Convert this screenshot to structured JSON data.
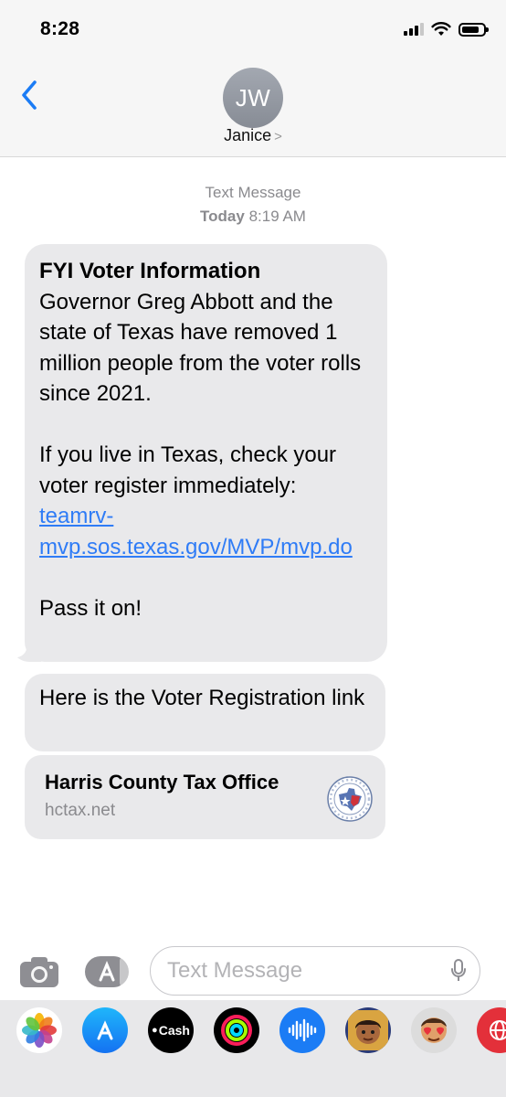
{
  "status_bar": {
    "time": "8:28"
  },
  "header": {
    "avatar_initials": "JW",
    "contact_name": "Janice"
  },
  "thread": {
    "timestamp_label": "Text Message",
    "timestamp_day": "Today",
    "timestamp_time": "8:19 AM"
  },
  "messages": {
    "first": {
      "title": "FYI Voter Information",
      "paragraph1": "Governor Greg Abbott and the state of Texas have removed 1 million people from the voter rolls since 2021.",
      "paragraph2_prefix": "If you live in Texas, check your voter register immediately:",
      "link_text": "teamrv-mvp.sos.texas.gov/MVP/mvp.do",
      "closing": "Pass it on!"
    },
    "second": {
      "text": "Here is the Voter Registration link"
    },
    "link_preview": {
      "title": "Harris County Tax Office",
      "domain": "hctax.net"
    }
  },
  "composer": {
    "placeholder": "Text Message"
  },
  "app_drawer": {
    "items": [
      "photos-icon",
      "app-store-icon",
      "apple-cash-icon",
      "fitness-icon",
      "audio-message-icon",
      "memoji-icon",
      "memoji-stickers-icon",
      "web-icon"
    ],
    "cash_label": "Cash"
  },
  "colors": {
    "link": "#2f7cf6",
    "back_chevron": "#1b7cf5",
    "bubble": "#e9e9eb",
    "bar_background": "#f6f6f6"
  }
}
